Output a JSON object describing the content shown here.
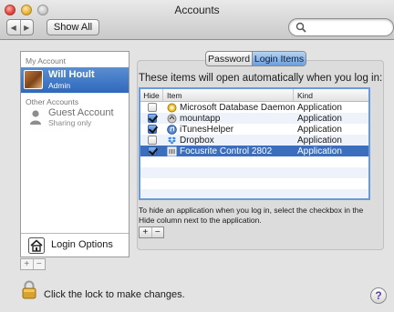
{
  "window": {
    "title": "Accounts"
  },
  "toolbar": {
    "back_label": "◀",
    "forward_label": "▶",
    "show_all_label": "Show All",
    "search_placeholder": ""
  },
  "sidebar": {
    "my_account_header": "My Account",
    "selected_user": {
      "name": "Will Hoult",
      "role": "Admin"
    },
    "other_accounts_header": "Other Accounts",
    "guest": {
      "name": "Guest Account",
      "status": "Sharing only"
    },
    "login_options_label": "Login Options",
    "add_label": "+",
    "remove_label": "−"
  },
  "tabs": {
    "password": "Password",
    "login_items": "Login Items",
    "selected": "login_items"
  },
  "login_items": {
    "intro": "These items will open automatically when you log in:",
    "columns": {
      "hide": "Hide",
      "item": "Item",
      "kind": "Kind"
    },
    "rows": [
      {
        "hide": false,
        "item": "Microsoft Database Daemon",
        "kind": "Application",
        "icon": "microsoft-db-icon"
      },
      {
        "hide": true,
        "item": "mountapp",
        "kind": "Application",
        "icon": "mountapp-icon"
      },
      {
        "hide": true,
        "item": "iTunesHelper",
        "kind": "Application",
        "icon": "itunes-icon"
      },
      {
        "hide": false,
        "item": "Dropbox",
        "kind": "Application",
        "icon": "dropbox-icon"
      },
      {
        "hide": true,
        "item": "Focusrite Control 2802",
        "kind": "Application",
        "icon": "focusrite-icon",
        "selected": true
      }
    ],
    "hint": "To hide an application when you log in, select the checkbox in the Hide column next to the application.",
    "add_label": "+",
    "remove_label": "−"
  },
  "footer": {
    "lock_text": "Click the lock to make changes.",
    "help_label": "?"
  },
  "colors": {
    "selection": "#3b6fbd",
    "sidebar_selection": "#2f69bd",
    "table_focus": "#6a9ad9"
  }
}
